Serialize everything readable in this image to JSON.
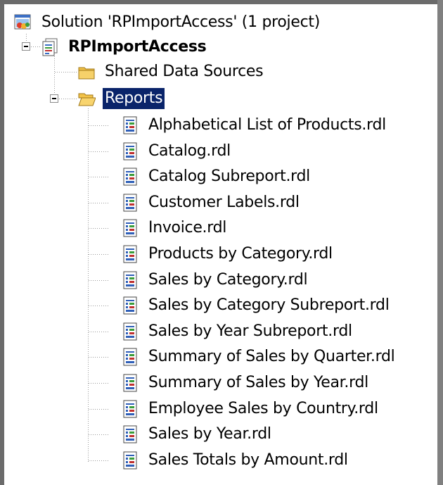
{
  "tree": {
    "solution_label": "Solution 'RPImportAccess' (1 project)",
    "project_label": "RPImportAccess",
    "shared_data_sources_label": "Shared Data Sources",
    "reports_label": "Reports",
    "reports": [
      "Alphabetical List of Products.rdl",
      "Catalog.rdl",
      "Catalog Subreport.rdl",
      "Customer Labels.rdl",
      "Invoice.rdl",
      "Products by Category.rdl",
      "Sales by Category.rdl",
      "Sales by Category Subreport.rdl",
      "Sales by Year Subreport.rdl",
      "Summary of Sales by Quarter.rdl",
      "Summary of Sales by Year.rdl",
      "Employee Sales by Country.rdl",
      "Sales by Year.rdl",
      "Sales Totals by Amount.rdl"
    ]
  },
  "colors": {
    "selection": "#0a246a",
    "folder": "#f2c248",
    "frame": "#6b6b6b"
  },
  "icons": {
    "solution": "solution-icon",
    "project": "report-project-icon",
    "folder_closed": "folder-icon",
    "folder_open": "folder-open-icon",
    "report": "report-file-icon"
  }
}
